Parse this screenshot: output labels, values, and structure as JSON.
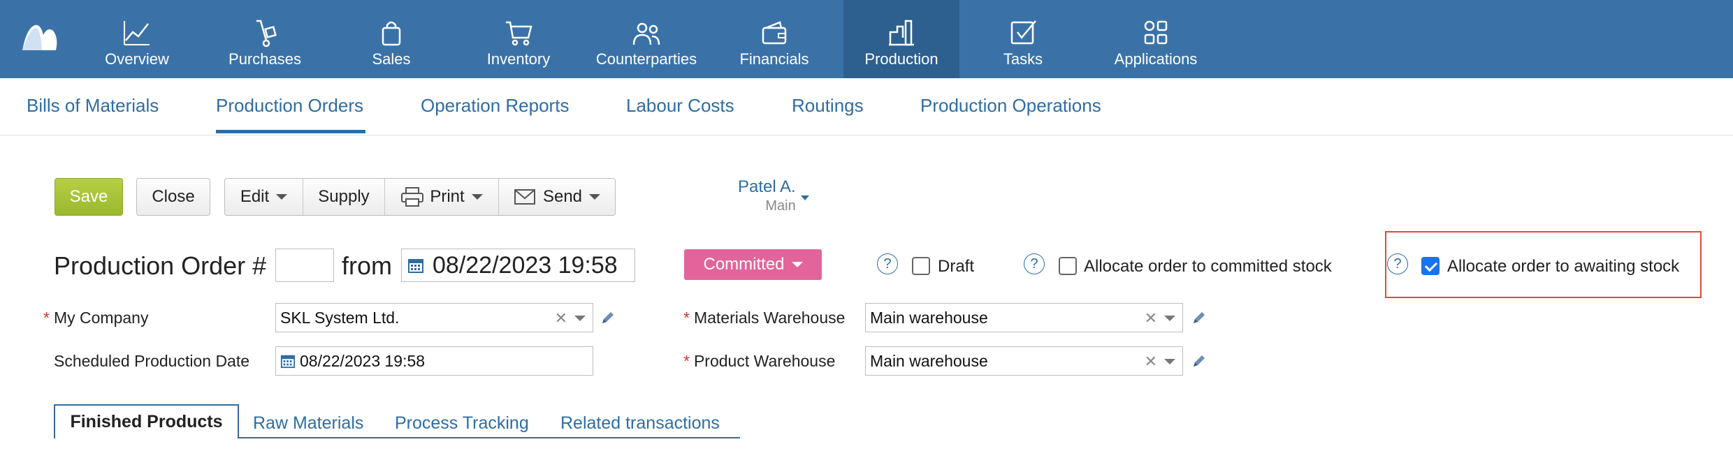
{
  "colors": {
    "nav_bg": "#3a72a8",
    "nav_active": "#2d5f8f",
    "link": "#2e6da4",
    "save": "#a7c23a",
    "status": "#e2649a",
    "highlight": "#e04a3a"
  },
  "topnav": {
    "items": [
      {
        "label": "Overview",
        "icon": "chart-line-icon"
      },
      {
        "label": "Purchases",
        "icon": "hand-truck-icon"
      },
      {
        "label": "Sales",
        "icon": "shopping-bag-icon"
      },
      {
        "label": "Inventory",
        "icon": "cart-icon"
      },
      {
        "label": "Counterparties",
        "icon": "people-icon"
      },
      {
        "label": "Financials",
        "icon": "wallet-icon"
      },
      {
        "label": "Production",
        "icon": "factory-icon",
        "active": true
      },
      {
        "label": "Tasks",
        "icon": "checkbox-icon"
      },
      {
        "label": "Applications",
        "icon": "apps-grid-icon"
      }
    ]
  },
  "subnav": {
    "items": [
      "Bills of Materials",
      "Production Orders",
      "Operation Reports",
      "Labour Costs",
      "Routings",
      "Production Operations"
    ],
    "active": "Production Orders"
  },
  "toolbar": {
    "save": "Save",
    "close": "Close",
    "edit": "Edit",
    "supply": "Supply",
    "print": "Print",
    "send": "Send"
  },
  "owner": {
    "name": "Patel A.",
    "sub": "Main"
  },
  "order": {
    "title": "Production Order #",
    "number": "",
    "from_label": "from",
    "date": "08/22/2023 19:58",
    "status": "Committed"
  },
  "options": {
    "draft": {
      "label": "Draft",
      "checked": false
    },
    "committed_stock": {
      "label": "Allocate order to committed stock",
      "checked": false
    },
    "awaiting_stock": {
      "label": "Allocate order to awaiting stock",
      "checked": true
    }
  },
  "form": {
    "company_label": "My Company",
    "company_value": "SKL System Ltd.",
    "scheduled_label": "Scheduled Production Date",
    "scheduled_value": "08/22/2023 19:58",
    "materials_wh_label": "Materials Warehouse",
    "materials_wh_value": "Main warehouse",
    "product_wh_label": "Product Warehouse",
    "product_wh_value": "Main warehouse"
  },
  "tabs": [
    "Finished Products",
    "Raw Materials",
    "Process Tracking",
    "Related transactions"
  ],
  "help_symbol": "?",
  "clear_symbol": "✕"
}
